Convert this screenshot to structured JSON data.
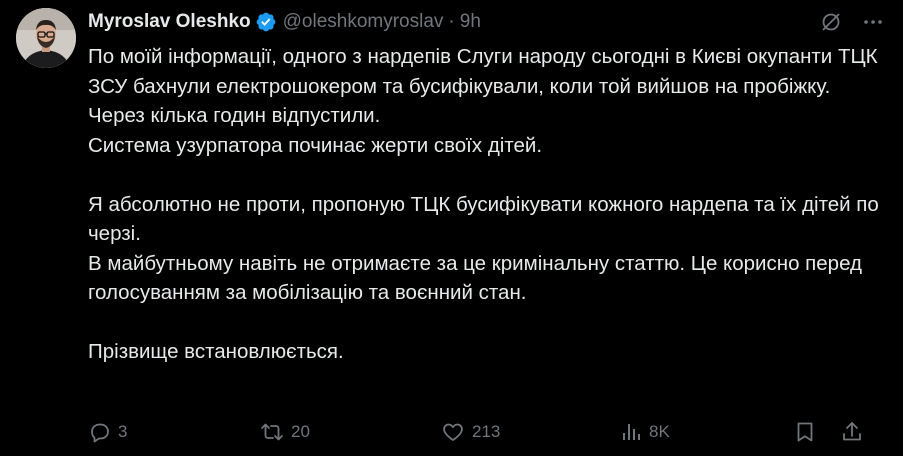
{
  "author": {
    "display_name": "Myroslav Oleshko",
    "handle": "@oleshkomyroslav",
    "separator": "·",
    "time": "9h",
    "verified": true,
    "verified_color": "#1d9bf0"
  },
  "tweet": {
    "paragraphs": [
      "По моїй інформації, одного з нардепів Слуги народу сьогодні в Києві окупанти ТЦК ЗСУ бахнули електрошокером та бусифікували, коли той вийшов на пробіжку.",
      "Через кілька годин відпустили.",
      "Система узурпатора починає жерти своїх дітей.",
      "",
      "Я абсолютно не проти, пропоную ТЦК бусифікувати кожного нардепа та їх дітей по черзі.",
      "В майбутньому навіть не отримаєте за це кримінальну статтю. Це корисно перед голосуванням за мобілізацію та воєнний стан.",
      "",
      "Прізвище встановлюється."
    ]
  },
  "actions": {
    "replies": "3",
    "reposts": "20",
    "likes": "213",
    "views": "8K"
  },
  "colors": {
    "background": "#000000",
    "text": "#e7e9ea",
    "muted": "#71767b",
    "accent": "#1d9bf0"
  },
  "icons": {
    "top": [
      "grok-icon",
      "more-icon"
    ],
    "actions": [
      "reply-icon",
      "repost-icon",
      "like-icon",
      "views-icon",
      "bookmark-icon",
      "share-icon"
    ]
  }
}
